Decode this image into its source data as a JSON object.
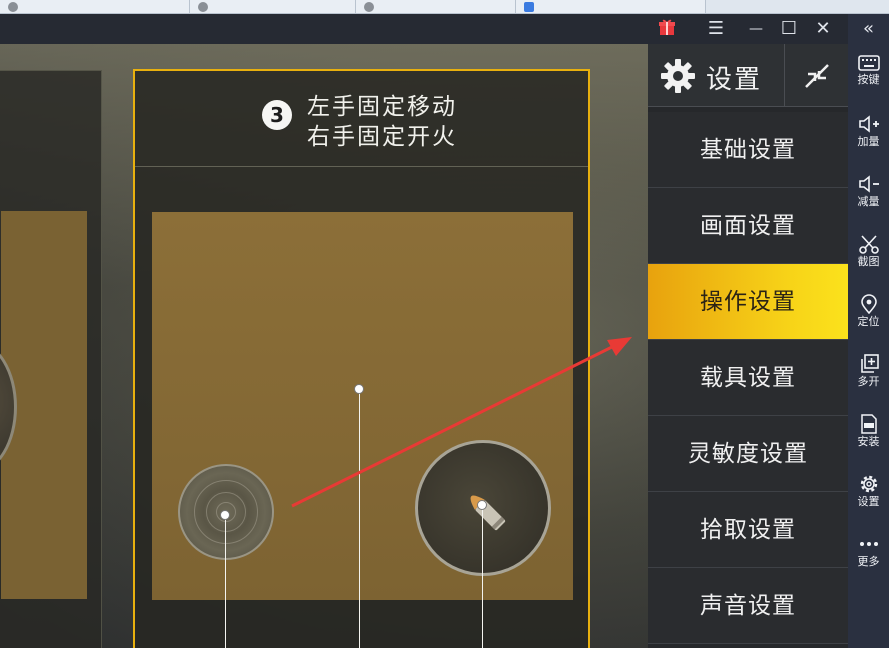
{
  "titlebar": {
    "menu_glyph": "☰",
    "minimize_glyph": "—",
    "maximize_glyph": "☐",
    "close_glyph": "✕"
  },
  "mode_card": {
    "number": "3",
    "line1": "左手固定移动",
    "line2": "右手固定开火"
  },
  "settings_panel": {
    "title": "设置",
    "items": [
      {
        "label": "基础设置",
        "active": false
      },
      {
        "label": "画面设置",
        "active": false
      },
      {
        "label": "操作设置",
        "active": true
      },
      {
        "label": "载具设置",
        "active": false
      },
      {
        "label": "灵敏度设置",
        "active": false
      },
      {
        "label": "拾取设置",
        "active": false
      },
      {
        "label": "声音设置",
        "active": false
      }
    ]
  },
  "sidebar": {
    "collapse_glyph": "«",
    "items": [
      {
        "label": "按键",
        "icon": "keyboard-icon"
      },
      {
        "label": "加量",
        "icon": "volume-up-icon"
      },
      {
        "label": "减量",
        "icon": "volume-down-icon"
      },
      {
        "label": "截图",
        "icon": "scissors-icon"
      },
      {
        "label": "定位",
        "icon": "location-pin-icon"
      },
      {
        "label": "多开",
        "icon": "multi-window-icon"
      },
      {
        "label": "安装",
        "icon": "apk-install-icon"
      },
      {
        "label": "设置",
        "icon": "gear-icon"
      },
      {
        "label": "更多",
        "icon": "more-dots-icon"
      }
    ]
  },
  "colors": {
    "accent_yellow": "#f7d318",
    "card_border": "#e8b00e",
    "arrow_red": "#e83a35",
    "panel_bg": "#26282b"
  }
}
